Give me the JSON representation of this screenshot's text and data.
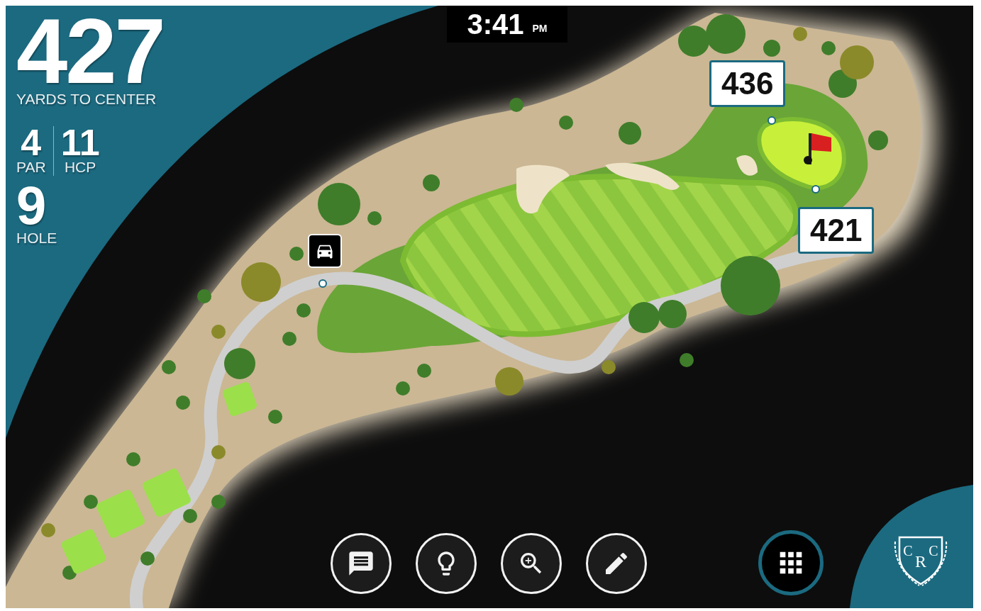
{
  "distance": {
    "value": "427",
    "label": "YARDS TO CENTER"
  },
  "par": {
    "value": "4",
    "label": "PAR"
  },
  "handicap": {
    "value": "11",
    "label": "HCP"
  },
  "hole": {
    "value": "9",
    "label": "HOLE"
  },
  "clock": {
    "time": "3:41",
    "period": "PM"
  },
  "markers": [
    {
      "kind": "back",
      "distance": "436"
    },
    {
      "kind": "front",
      "distance": "421"
    }
  ],
  "toolbar": [
    {
      "kind": "message"
    },
    {
      "kind": "tip"
    },
    {
      "kind": "zoom"
    },
    {
      "kind": "edit"
    }
  ],
  "logo": {
    "letters": [
      "C",
      "R",
      "C"
    ]
  }
}
